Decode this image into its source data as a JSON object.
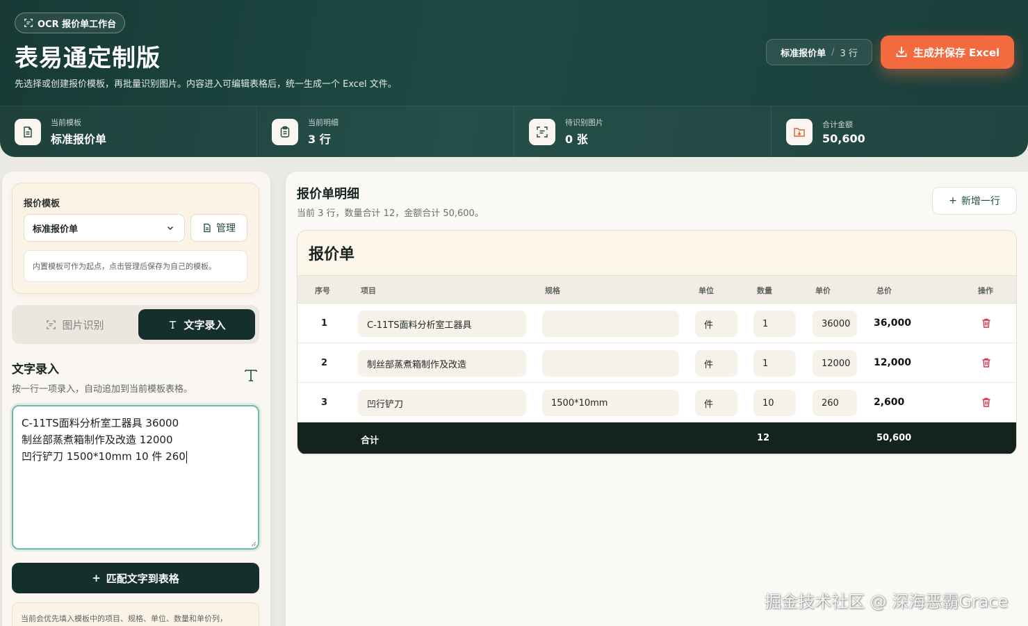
{
  "header": {
    "badge": "OCR 报价单工作台",
    "title": "表易通定制版",
    "subtitle": "先选择或创建报价模板，再批量识别图片。内容进入可编辑表格后，统一生成一个 Excel 文件。",
    "template_pill": {
      "name": "标准报价单",
      "separator": "/",
      "rows": "3 行"
    },
    "excel_button": "生成并保存 Excel"
  },
  "stats": [
    {
      "label": "当前模板",
      "value": "标准报价单",
      "icon": "document-icon"
    },
    {
      "label": "当前明细",
      "value": "3 行",
      "icon": "clipboard-icon"
    },
    {
      "label": "待识别图片",
      "value": "0 张",
      "icon": "scan-icon"
    },
    {
      "label": "合计金额",
      "value": "50,600",
      "icon": "folder-download-icon"
    }
  ],
  "left": {
    "template_label": "报价模板",
    "template_selected": "标准报价单",
    "manage_button": "管理",
    "template_hint": "内置模板可作为起点，点击管理后保存为自己的模板。",
    "tabs": {
      "image": "图片识别",
      "text": "文字录入"
    },
    "text_title": "文字录入",
    "text_desc": "按一行一项录入，自动追加到当前模板表格。",
    "text_lines": [
      "C-11TS面料分析室工器具 36000",
      "制丝部蒸煮箱制作及改造 12000",
      "凹行铲刀 1500*10mm 10 件 260"
    ],
    "match_button": "匹配文字到表格",
    "note": "当前会优先填入模板中的项目、规格、单位、数量和单价列，"
  },
  "right": {
    "title": "报价单明细",
    "subtitle": "当前 3 行，数量合计 12，金额合计 50,600。",
    "add_button": "新增一行",
    "quote_title": "报价单",
    "columns": [
      "序号",
      "项目",
      "规格",
      "单位",
      "数量",
      "单价",
      "总价",
      "操作"
    ],
    "rows": [
      {
        "seq": "1",
        "item": "C-11TS面料分析室工器具",
        "spec": "",
        "unit": "件",
        "qty": "1",
        "price": "36000",
        "total": "36,000"
      },
      {
        "seq": "2",
        "item": "制丝部蒸煮箱制作及改造",
        "spec": "",
        "unit": "件",
        "qty": "1",
        "price": "12000",
        "total": "12,000"
      },
      {
        "seq": "3",
        "item": "凹行铲刀",
        "spec": "1500*10mm",
        "unit": "件",
        "qty": "10",
        "price": "260",
        "total": "2,600"
      }
    ],
    "sum": {
      "label": "合计",
      "qty": "12",
      "total": "50,600"
    }
  },
  "watermark": "掘金技术社区 @ 深海恶霸Grace",
  "colors": {
    "header_bg": "#1a4540",
    "accent": "#f26a3d",
    "dark": "#15302c",
    "danger": "#d2354f"
  }
}
